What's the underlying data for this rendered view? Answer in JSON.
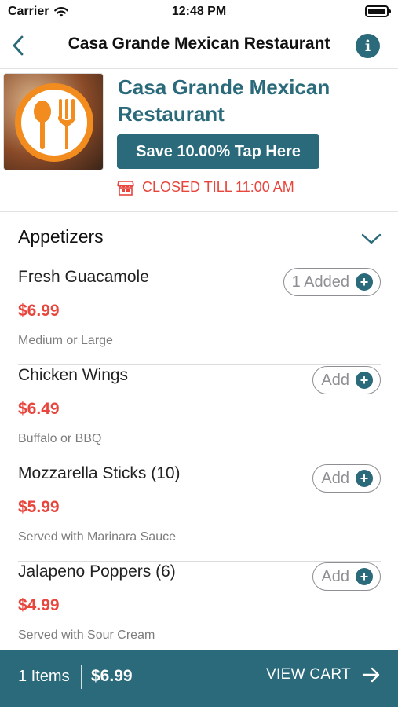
{
  "status_bar": {
    "carrier": "Carrier",
    "time": "12:48 PM"
  },
  "nav": {
    "title": "Casa Grande Mexican Restaurant",
    "back_icon": "chevron-left-icon",
    "info_icon": "info-icon"
  },
  "restaurant": {
    "name": "Casa Grande Mexican Restaurant",
    "save_label": "Save 10.00% Tap Here",
    "status": "CLOSED TILL 11:00 AM",
    "status_icon": "store-icon"
  },
  "category": {
    "title": "Appetizers",
    "icon": "chevron-down-icon"
  },
  "items": [
    {
      "name": "Fresh Guacamole",
      "price": "$6.99",
      "description": "Medium or Large",
      "button": "1 Added"
    },
    {
      "name": "Chicken Wings",
      "price": "$6.49",
      "description": "Buffalo or BBQ",
      "button": "Add"
    },
    {
      "name": "Mozzarella Sticks (10)",
      "price": "$5.99",
      "description": "Served with Marinara Sauce",
      "button": "Add"
    },
    {
      "name": "Jalapeno Poppers (6)",
      "price": "$4.99",
      "description": "Served with Sour Cream",
      "button": "Add"
    }
  ],
  "cart": {
    "count": "1 Items",
    "total": "$6.99",
    "action": "VIEW CART"
  },
  "colors": {
    "accent": "#2a6a7b",
    "price": "#e8453c",
    "logo_orange": "#f28c1e"
  }
}
